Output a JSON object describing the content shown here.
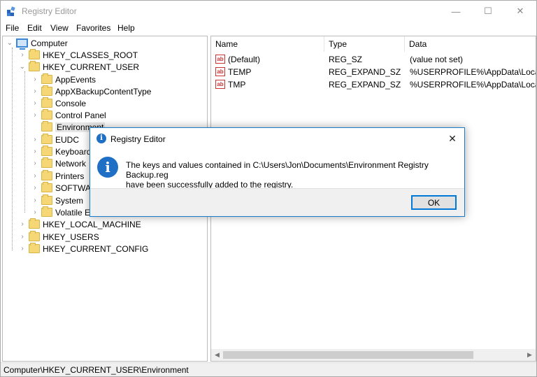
{
  "window": {
    "title": "Registry Editor",
    "controls": {
      "minimize": "—",
      "maximize": "☐",
      "close": "✕"
    }
  },
  "menu": [
    "File",
    "Edit",
    "View",
    "Favorites",
    "Help"
  ],
  "tree": {
    "root": "Computer",
    "hives": [
      "HKEY_CLASSES_ROOT",
      "HKEY_CURRENT_USER"
    ],
    "current_user_children": [
      "AppEvents",
      "AppXBackupContentType",
      "Console",
      "Control Panel",
      "Environment",
      "EUDC",
      "Keyboard",
      "Network",
      "Printers",
      "SOFTWA",
      "System",
      "Volatile E"
    ],
    "other_hives": [
      "HKEY_LOCAL_MACHINE",
      "HKEY_USERS",
      "HKEY_CURRENT_CONFIG"
    ],
    "selected": "Environment"
  },
  "list": {
    "headers": {
      "name": "Name",
      "type": "Type",
      "data": "Data"
    },
    "rows": [
      {
        "name": "(Default)",
        "type": "REG_SZ",
        "data": "(value not set)"
      },
      {
        "name": "TEMP",
        "type": "REG_EXPAND_SZ",
        "data": "%USERPROFILE%\\AppData\\Local\\Te"
      },
      {
        "name": "TMP",
        "type": "REG_EXPAND_SZ",
        "data": "%USERPROFILE%\\AppData\\Local\\Te"
      }
    ],
    "icon": "ab"
  },
  "status": {
    "path": "Computer\\HKEY_CURRENT_USER\\Environment"
  },
  "dialog": {
    "title": "Registry Editor",
    "message_line1": "The keys and values contained in C:\\Users\\Jon\\Documents\\Environment Registry Backup.reg",
    "message_line2": "have been successfully added to the registry.",
    "ok_label": "OK",
    "icon": "i",
    "close": "✕"
  },
  "glyphs": {
    "expand": "›",
    "collapse": "⌄",
    "scroll_left": "◀",
    "scroll_right": "▶"
  },
  "colors": {
    "accent": "#0078d7",
    "info_icon": "#1f6fc5",
    "folder": "#f6d776"
  }
}
